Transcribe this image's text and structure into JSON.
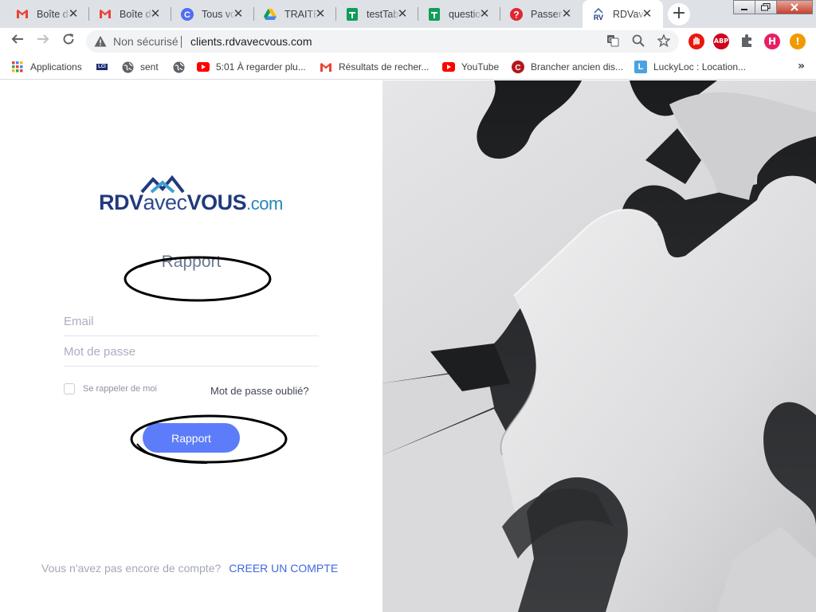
{
  "browser": {
    "tabs": [
      {
        "title": "Boîte de réception",
        "icon": "gmail-icon"
      },
      {
        "title": "Boîte de réception",
        "icon": "gmail-icon"
      },
      {
        "title": "Tous vos",
        "icon": "c-circle-icon"
      },
      {
        "title": "TRAITEMENT",
        "icon": "google-drive-icon"
      },
      {
        "title": "testTableau",
        "icon": "google-sheets-icon"
      },
      {
        "title": "questionnaire",
        "icon": "google-sheets-icon"
      },
      {
        "title": "Passer",
        "icon": "question-circle-icon"
      },
      {
        "title": "RDVavecVOUS",
        "icon": "rv-logo-icon"
      }
    ],
    "new_tab_label": "+",
    "close_glyph": "✕",
    "address": {
      "security_label": "Non sécurisé",
      "url": "clients.rdvavecvous.com"
    },
    "profile_initial": "H",
    "abp_label": "ABP",
    "alert_glyph": "!",
    "bookmarks": [
      {
        "label": "Applications",
        "icon": "apps-grid-icon"
      },
      {
        "label": "",
        "icon": "lci-icon",
        "icon_text": "LCI"
      },
      {
        "label": "sent",
        "icon": "globe-icon"
      },
      {
        "label": "",
        "icon": "globe-icon"
      },
      {
        "label": "5:01 À regarder plu...",
        "icon": "youtube-icon"
      },
      {
        "label": "Résultats de recher...",
        "icon": "gmail-icon"
      },
      {
        "label": "YouTube",
        "icon": "youtube-icon"
      },
      {
        "label": "Brancher ancien dis...",
        "icon": "red-c-icon"
      },
      {
        "label": "LuckyLoc : Location...",
        "icon": "l-square-icon",
        "icon_text": "L"
      }
    ],
    "more_glyph": "»",
    "colors": {
      "tabstrip": "#dee1e6",
      "gmail_red": "#ea4335",
      "youtube_red": "#ff0000",
      "sheets_green": "#0f9d58"
    }
  },
  "login": {
    "logo": {
      "part1": "RDV",
      "part2": "avec",
      "part3": "VOUS",
      "part4": ".com"
    },
    "title": "Rapport",
    "email_placeholder": "Email",
    "password_placeholder": "Mot de passe",
    "remember_label": "Se rappeler de moi",
    "forgot_label": "Mot de passe oublié?",
    "submit_label": "Rapport",
    "signup_question": "Vous n'avez pas encore de compte?",
    "signup_link": "CREER UN COMPTE",
    "colors": {
      "accent": "#5c7cfa",
      "link": "#4168e0",
      "title": "#6b7892"
    }
  },
  "hero_image": {
    "subject": "puzzle-pieces-image"
  }
}
